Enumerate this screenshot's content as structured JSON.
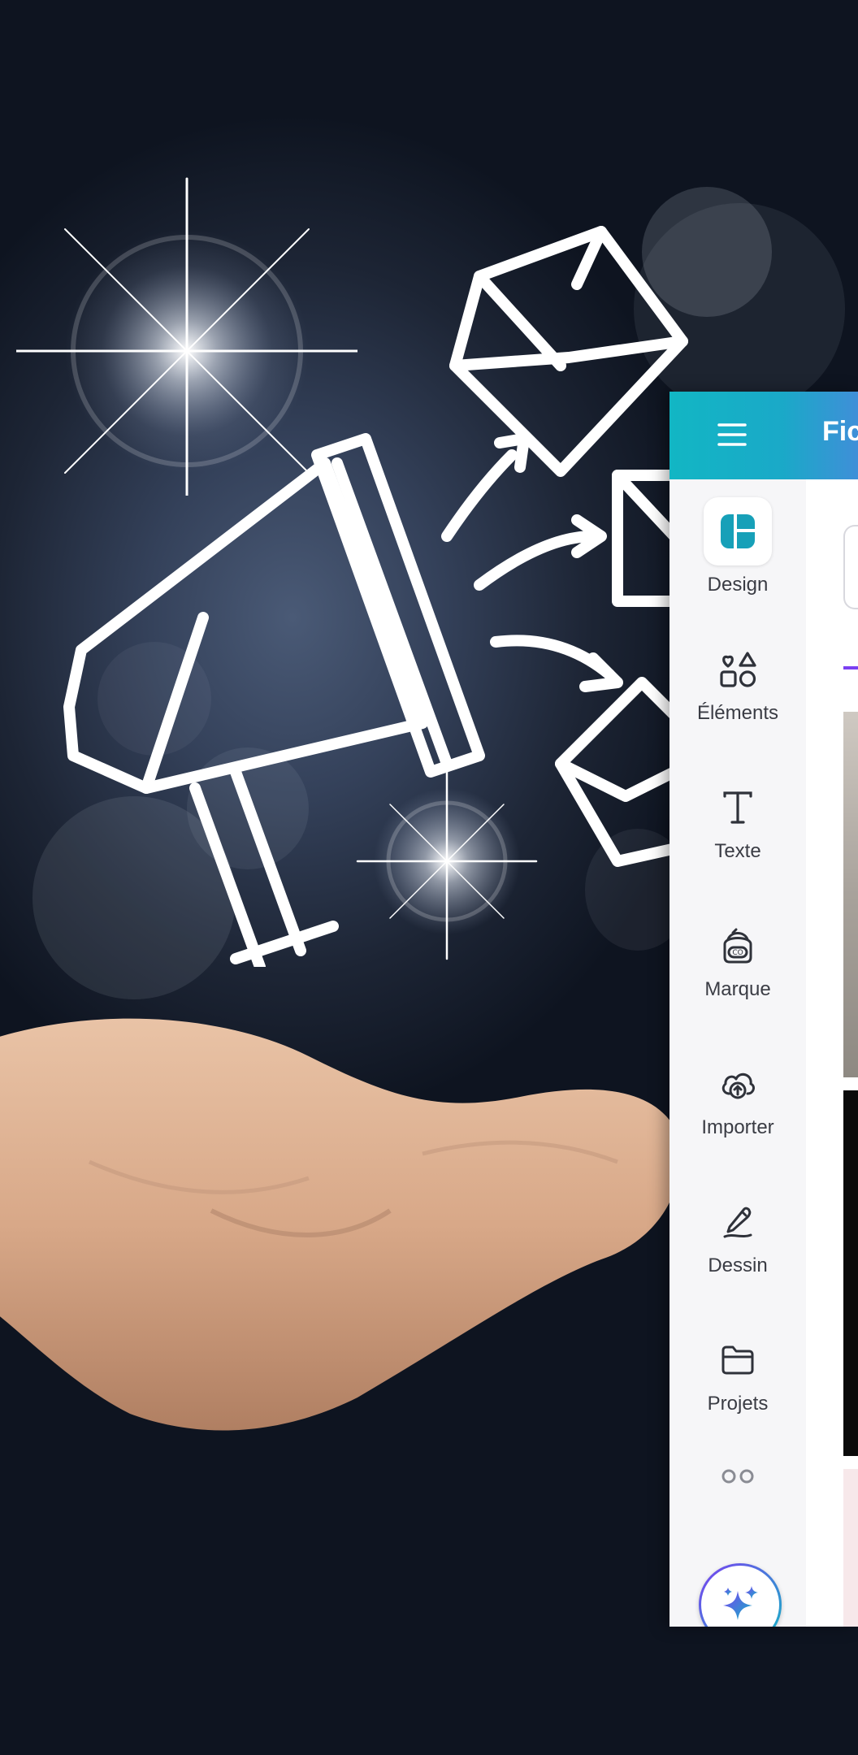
{
  "app": {
    "menu_icon": "hamburger-menu-icon",
    "topbar_title": "Fic",
    "colors": {
      "topbar_start": "#12b6c4",
      "topbar_end": "#3f8fd8",
      "tab_indicator": "#7b3ff2",
      "design_icon": "#17a0b8"
    }
  },
  "sidebar": {
    "items": [
      {
        "label": "Design",
        "icon": "design-layout-icon",
        "active": true
      },
      {
        "label": "Éléments",
        "icon": "shapes-icon",
        "active": false
      },
      {
        "label": "Texte",
        "icon": "text-t-icon",
        "active": false
      },
      {
        "label": "Marque",
        "icon": "brand-kit-icon",
        "active": false
      },
      {
        "label": "Importer",
        "icon": "cloud-upload-icon",
        "active": false
      },
      {
        "label": "Dessin",
        "icon": "draw-pen-icon",
        "active": false
      },
      {
        "label": "Projets",
        "icon": "folder-icon",
        "active": false
      },
      {
        "label": "",
        "icon": "apps-icon",
        "active": false
      }
    ],
    "magic_button_icon": "sparkles-icon"
  }
}
